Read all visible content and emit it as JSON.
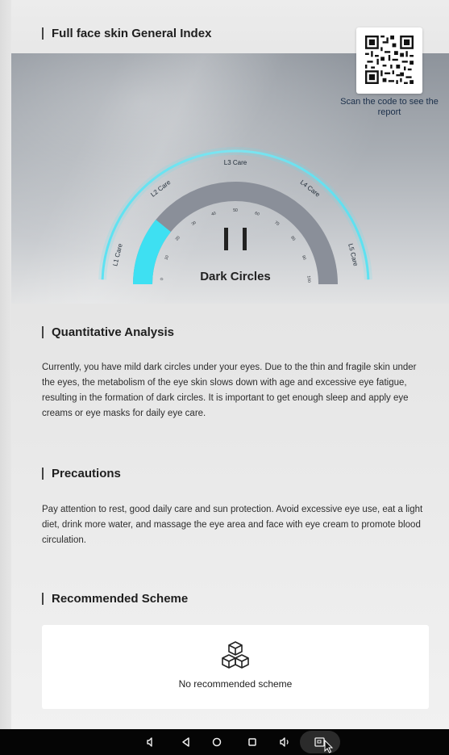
{
  "header": {
    "title": "Full face skin General Index"
  },
  "qr": {
    "caption": "Scan the code to see the report"
  },
  "gauge": {
    "metric_label": "Dark Circles",
    "grade": "II",
    "level_labels": [
      "L1 Care",
      "L2 Care",
      "L3 Care",
      "L4 Care",
      "L5 Care"
    ],
    "active_level": 1,
    "highlight_fraction": 0.2,
    "scale_ticks": [
      "0",
      "10",
      "20",
      "30",
      "40",
      "50",
      "60",
      "70",
      "80",
      "90",
      "100"
    ],
    "colors": {
      "active": "#3ee0f2",
      "track": "#8a8f99",
      "outer_ring": "#57dff0"
    }
  },
  "quantitative": {
    "title": "Quantitative Analysis",
    "text": "Currently, you have mild dark circles under your eyes. Due to the thin and fragile skin under the eyes, the metabolism of the eye skin slows down with age and excessive eye fatigue, resulting in the formation of dark circles. It is important to get enough sleep and apply eye creams or eye masks for daily eye care."
  },
  "precautions": {
    "title": "Precautions",
    "text": "Pay attention to rest, good daily care and sun protection. Avoid excessive eye use, eat a light diet, drink more water, and massage the eye area and face with eye cream to promote blood circulation."
  },
  "recommended": {
    "title": "Recommended Scheme",
    "empty_text": "No recommended scheme",
    "icon": "cubes-icon"
  },
  "navbar": {
    "buttons": [
      "volume-down-icon",
      "back-icon",
      "home-icon",
      "recents-icon",
      "volume-up-icon",
      "screenshot-icon"
    ]
  }
}
